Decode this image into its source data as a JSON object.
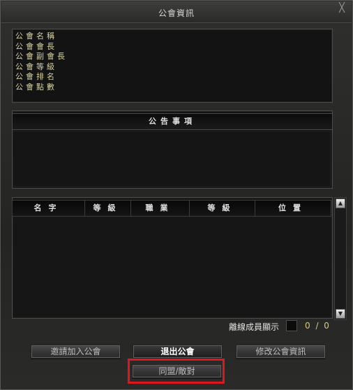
{
  "window": {
    "title": "公會資訊",
    "close_label": "╳"
  },
  "info": {
    "items": [
      "公會名稱",
      "公會會長",
      "公會副會長",
      "公會等級",
      "公會排名",
      "公會點數"
    ]
  },
  "notice": {
    "header": "公告事項"
  },
  "members": {
    "columns": [
      "名字",
      "等級",
      "職業",
      "等級",
      "位置"
    ]
  },
  "scroll": {
    "up": "▲",
    "down": "▼"
  },
  "footer": {
    "offline_label": "離線成員顯示",
    "offline_checked": false,
    "count": "0 / 0"
  },
  "buttons": {
    "invite": "邀請加入公會",
    "leave": "退出公會",
    "edit": "修改公會資訊",
    "alliance": "同盟/敵對"
  },
  "colors": {
    "highlight": "#e0161e",
    "accent_text": "#d8c880"
  }
}
